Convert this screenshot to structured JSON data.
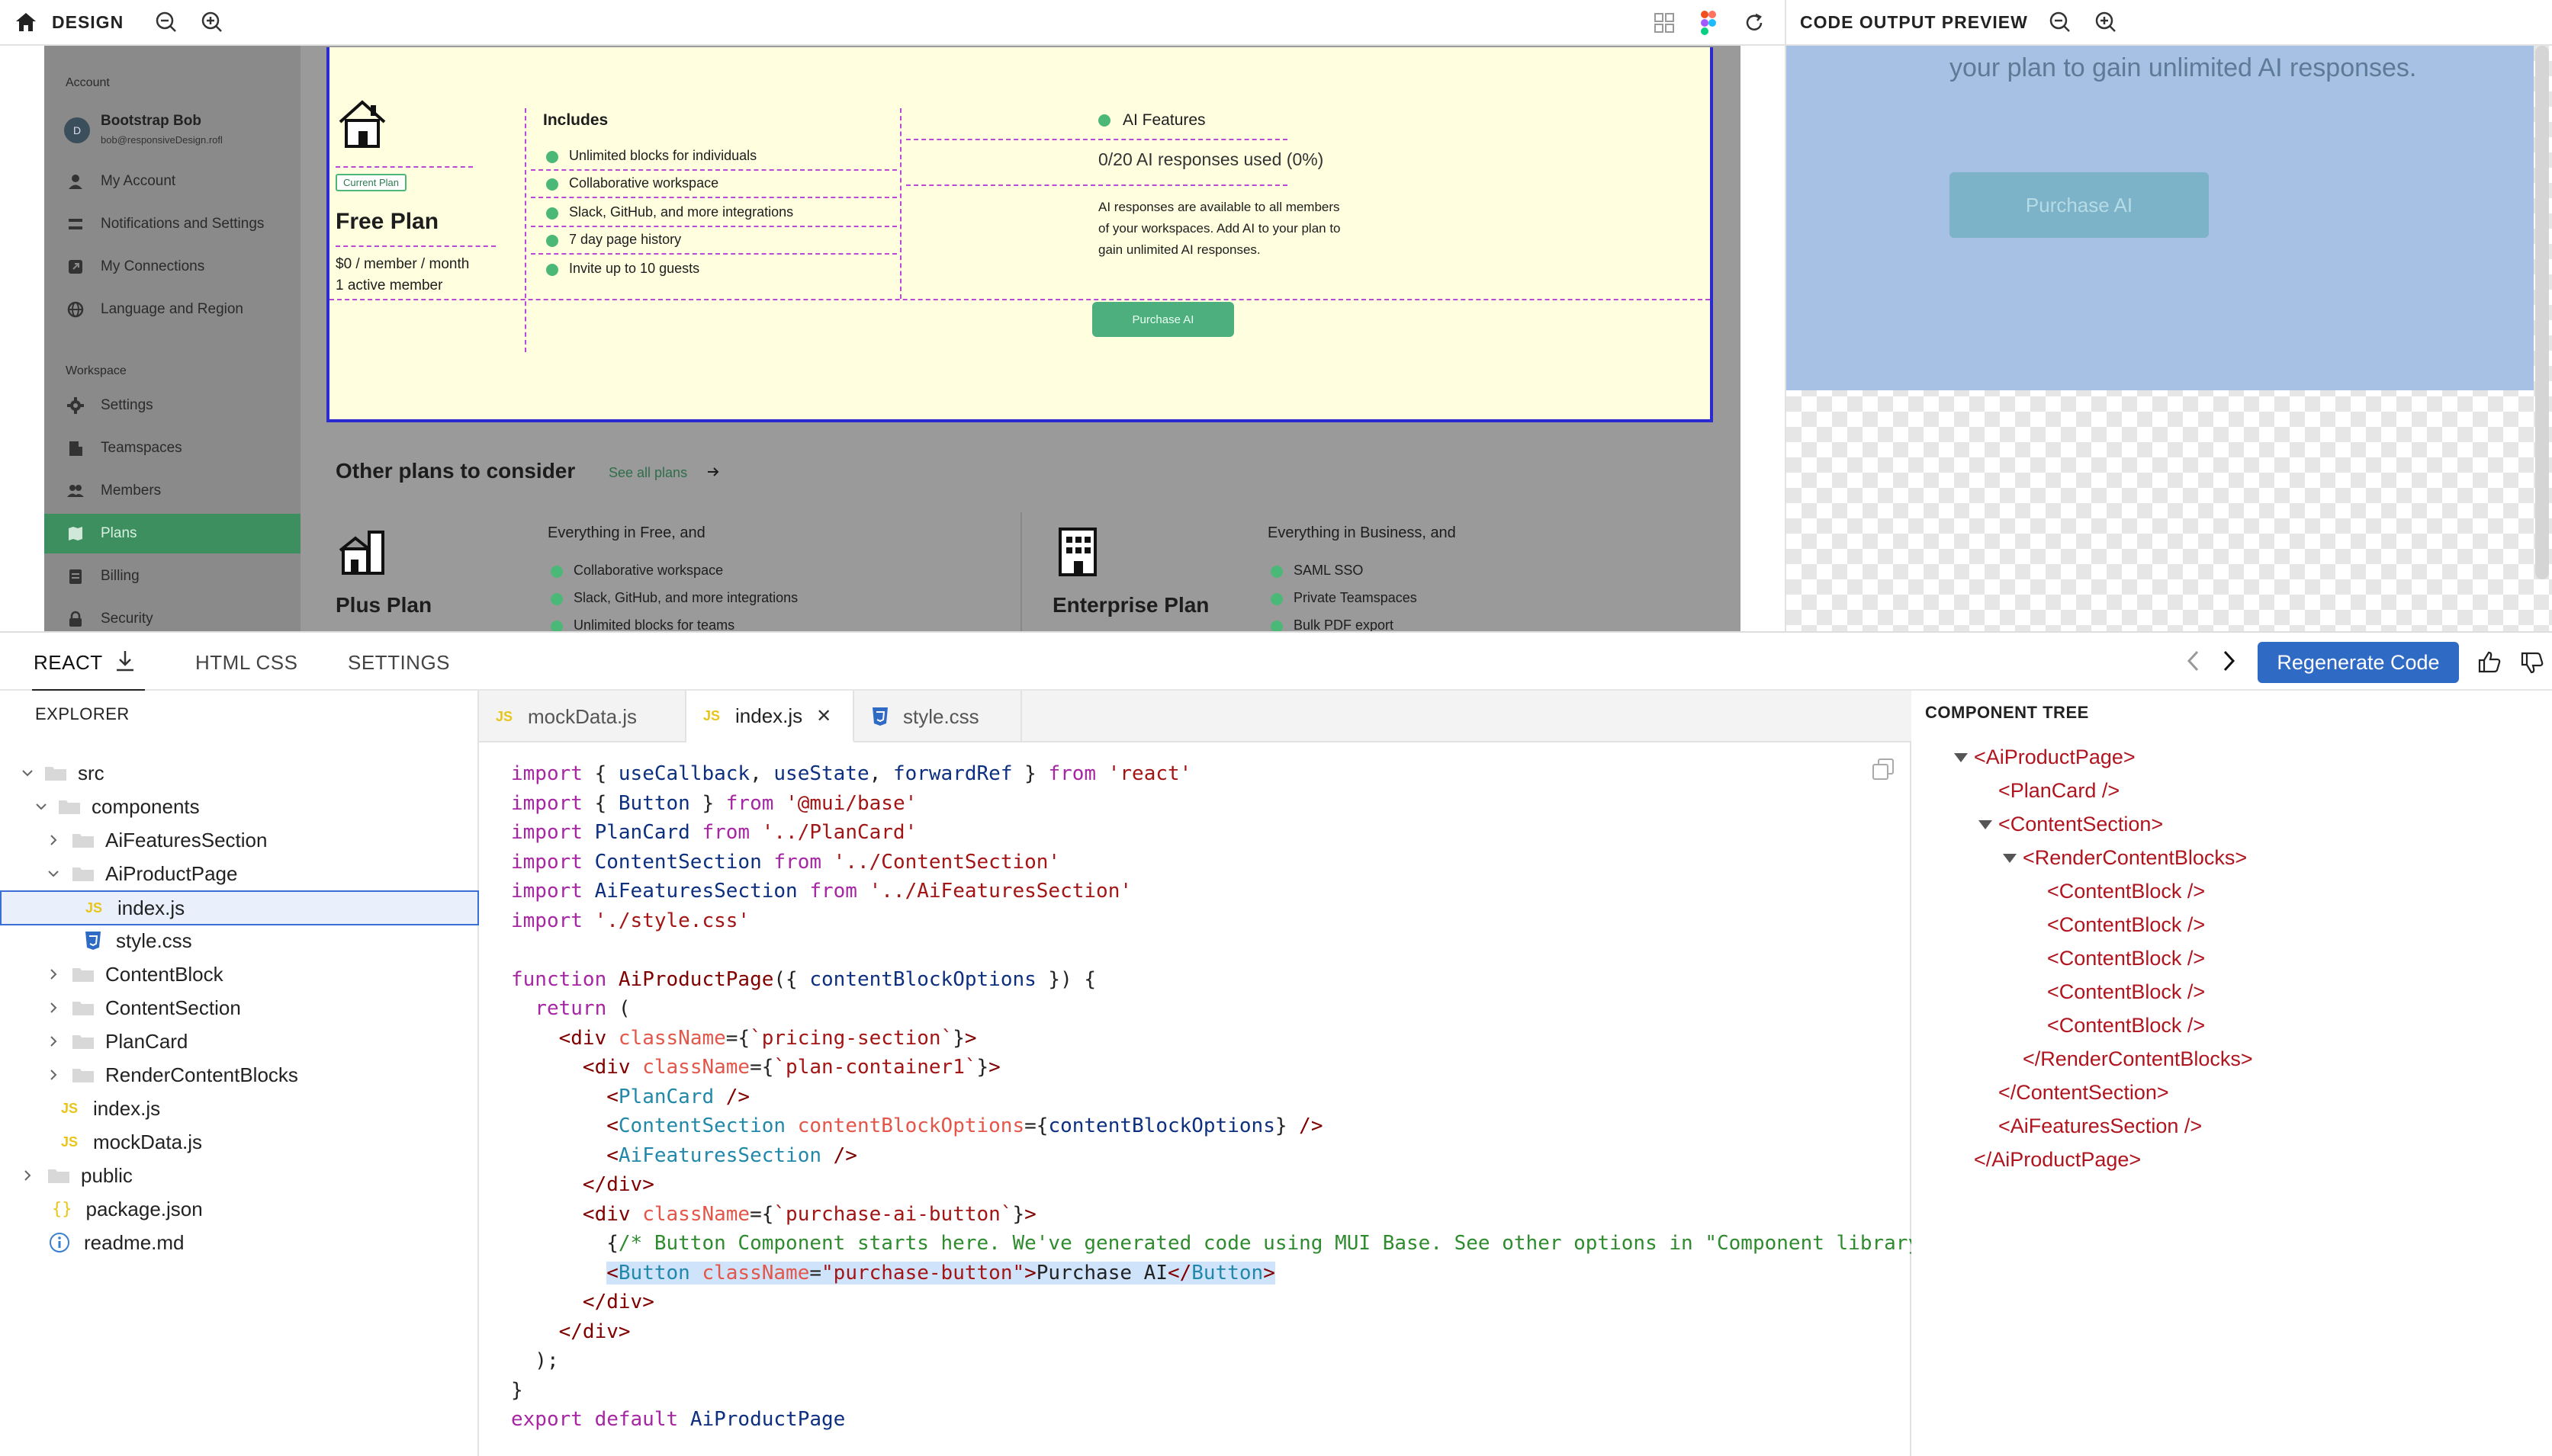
{
  "design_bar": {
    "title": "DESIGN"
  },
  "preview_bar": {
    "title": "CODE OUTPUT PREVIEW"
  },
  "sidebar": {
    "section_account": "Account",
    "user_name": "Bootstrap Bob",
    "user_email": "bob@responsiveDesign.rofl",
    "avatar_letter": "D",
    "account_items": [
      "My Account",
      "Notifications and Settings",
      "My Connections",
      "Language and Region"
    ],
    "section_workspace": "Workspace",
    "workspace_items": [
      "Settings",
      "Teamspaces",
      "Members",
      "Plans",
      "Billing",
      "Security"
    ],
    "active_item": "Plans"
  },
  "plan": {
    "badge": "Current Plan",
    "name": "Free Plan",
    "price": "$0 / member / month",
    "members": "1 active member",
    "includes_title": "Includes",
    "includes": [
      "Unlimited blocks for individuals",
      "Collaborative workspace",
      "Slack, GitHub, and more integrations",
      "7 day page history",
      "Invite up to 10 guests"
    ],
    "ai_title": "AI Features",
    "ai_usage": "0/20 AI responses used (0%)",
    "ai_desc_1": "AI responses are available to all members",
    "ai_desc_2": "of your workspaces. Add AI to your plan to",
    "ai_desc_3": "gain unlimited AI responses.",
    "purchase_button": "Purchase AI"
  },
  "other_plans": {
    "title": "Other plans to consider",
    "see_all": "See all plans",
    "plus": {
      "name": "Plus Plan",
      "heading": "Everything in Free, and",
      "features": [
        "Collaborative workspace",
        "Slack, GitHub, and more integrations",
        "Unlimited blocks for teams"
      ]
    },
    "enterprise": {
      "name": "Enterprise Plan",
      "heading": "Everything in Business, and",
      "features": [
        "SAML SSO",
        "Private Teamspaces",
        "Bulk PDF export"
      ]
    }
  },
  "preview": {
    "text": "your plan to gain unlimited AI responses.",
    "button": "Purchase AI"
  },
  "main_tabs": {
    "react": "REACT",
    "html_css": "HTML CSS",
    "settings": "SETTINGS",
    "regenerate": "Regenerate Code"
  },
  "explorer": {
    "title": "EXPLORER",
    "rows": [
      "src",
      "components",
      "AiFeaturesSection",
      "AiProductPage",
      "index.js",
      "style.css",
      "ContentBlock",
      "ContentSection",
      "PlanCard",
      "RenderContentBlocks",
      "index.js",
      "mockData.js",
      "public",
      "package.json",
      "readme.md"
    ]
  },
  "file_tabs": [
    "mockData.js",
    "index.js",
    "style.css"
  ],
  "component_tree": {
    "title": "COMPONENT TREE",
    "rows": [
      "<AiProductPage>",
      "<PlanCard />",
      "<ContentSection>",
      "<RenderContentBlocks>",
      "<ContentBlock />",
      "<ContentBlock />",
      "<ContentBlock />",
      "<ContentBlock />",
      "<ContentBlock />",
      "</RenderContentBlocks>",
      "</ContentSection>",
      "<AiFeaturesSection />",
      "</AiProductPage>"
    ]
  },
  "colors": {
    "accent_green": "#3d8f5f",
    "regen_blue": "#2f6bc4",
    "card_bg": "#ffffe0",
    "preview_blue": "#a6c1e3"
  }
}
